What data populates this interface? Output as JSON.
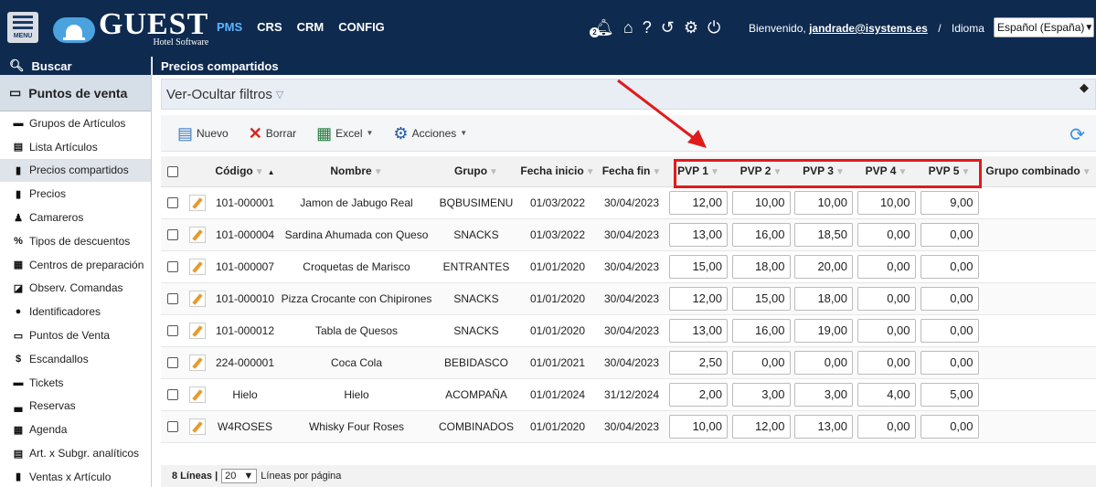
{
  "topbar": {
    "menu_label": "MENU",
    "logo_main": "GUEST",
    "logo_sub": "Hotel Software",
    "nav": [
      "PMS",
      "CRS",
      "CRM",
      "CONFIG"
    ],
    "notification_count": "2",
    "welcome_prefix": "Bienvenido,",
    "user": "jandrade@isystems.es",
    "separator": "/",
    "language_label": "Idioma",
    "language_value": "Español (España)"
  },
  "sidebar": {
    "search_label": "Buscar",
    "section_title": "Puntos de venta",
    "items": [
      {
        "label": "Grupos de Artículos",
        "icon": "folder-icon",
        "glyph": "▬"
      },
      {
        "label": "Lista Artículos",
        "icon": "list-icon",
        "glyph": "▤"
      },
      {
        "label": "Precios compartidos",
        "icon": "file-icon",
        "glyph": "▮"
      },
      {
        "label": "Precios",
        "icon": "price-file-icon",
        "glyph": "▮"
      },
      {
        "label": "Camareros",
        "icon": "person-icon",
        "glyph": "♟"
      },
      {
        "label": "Tipos de descuentos",
        "icon": "percent-icon",
        "glyph": "%"
      },
      {
        "label": "Centros de preparación",
        "icon": "building-icon",
        "glyph": "▦"
      },
      {
        "label": "Observ. Comandas",
        "icon": "edit-square-icon",
        "glyph": "◪"
      },
      {
        "label": "Identificadores",
        "icon": "id-icon",
        "glyph": "●"
      },
      {
        "label": "Puntos de Venta",
        "icon": "monitor-icon",
        "glyph": "▭"
      },
      {
        "label": "Escandallos",
        "icon": "dollar-icon",
        "glyph": "$"
      },
      {
        "label": "Tickets",
        "icon": "ticket-icon",
        "glyph": "▬"
      },
      {
        "label": "Reservas",
        "icon": "couch-icon",
        "glyph": "▃"
      },
      {
        "label": "Agenda",
        "icon": "calendar-icon",
        "glyph": "▦"
      },
      {
        "label": "Art. x Subgr. analíticos",
        "icon": "list-icon",
        "glyph": "▤"
      },
      {
        "label": "Ventas x Artículo",
        "icon": "file-icon",
        "glyph": "▮"
      }
    ],
    "active_index": 2
  },
  "main": {
    "page_title": "Precios compartidos",
    "filters_label": "Ver-Ocultar filtros",
    "toolbar": {
      "new_label": "Nuevo",
      "delete_label": "Borrar",
      "excel_label": "Excel",
      "actions_label": "Acciones"
    },
    "columns": [
      "Código",
      "Nombre",
      "Grupo",
      "Fecha inicio",
      "Fecha fin",
      "PVP 1",
      "PVP 2",
      "PVP 3",
      "PVP 4",
      "PVP 5",
      "Grupo combinado"
    ],
    "rows": [
      {
        "codigo": "101-000001",
        "nombre": "Jamon de Jabugo Real",
        "grupo": "BQBUSIMENU",
        "inicio": "01/03/2022",
        "fin": "30/04/2023",
        "pvp": [
          "12,00",
          "10,00",
          "10,00",
          "10,00",
          "9,00"
        ]
      },
      {
        "codigo": "101-000004",
        "nombre": "Sardina Ahumada con Queso",
        "grupo": "SNACKS",
        "inicio": "01/03/2022",
        "fin": "30/04/2023",
        "pvp": [
          "13,00",
          "16,00",
          "18,50",
          "0,00",
          "0,00"
        ]
      },
      {
        "codigo": "101-000007",
        "nombre": "Croquetas de Marisco",
        "grupo": "ENTRANTES",
        "inicio": "01/01/2020",
        "fin": "30/04/2023",
        "pvp": [
          "15,00",
          "18,00",
          "20,00",
          "0,00",
          "0,00"
        ]
      },
      {
        "codigo": "101-000010",
        "nombre": "Pizza Crocante con Chipirones",
        "grupo": "SNACKS",
        "inicio": "01/01/2020",
        "fin": "30/04/2023",
        "pvp": [
          "12,00",
          "15,00",
          "18,00",
          "0,00",
          "0,00"
        ]
      },
      {
        "codigo": "101-000012",
        "nombre": "Tabla de Quesos",
        "grupo": "SNACKS",
        "inicio": "01/01/2020",
        "fin": "30/04/2023",
        "pvp": [
          "13,00",
          "16,00",
          "19,00",
          "0,00",
          "0,00"
        ]
      },
      {
        "codigo": "224-000001",
        "nombre": "Coca Cola",
        "grupo": "BEBIDASCO",
        "inicio": "01/01/2021",
        "fin": "30/04/2023",
        "pvp": [
          "2,50",
          "0,00",
          "0,00",
          "0,00",
          "0,00"
        ]
      },
      {
        "codigo": "Hielo",
        "nombre": "Hielo",
        "grupo": "ACOMPAÑA",
        "inicio": "01/01/2024",
        "fin": "31/12/2024",
        "pvp": [
          "2,00",
          "3,00",
          "3,00",
          "4,00",
          "5,00"
        ]
      },
      {
        "codigo": "W4ROSES",
        "nombre": "Whisky Four Roses",
        "grupo": "COMBINADOS",
        "inicio": "01/01/2020",
        "fin": "30/04/2023",
        "pvp": [
          "10,00",
          "12,00",
          "13,00",
          "0,00",
          "0,00"
        ]
      }
    ],
    "pager": {
      "count_text": "8 Líneas |",
      "page_size": "20",
      "per_page_label": "Líneas por página"
    }
  },
  "colors": {
    "navy": "#0e2a4f",
    "active_nav": "#5fb4ff",
    "annotation_red": "#e01b1b"
  }
}
